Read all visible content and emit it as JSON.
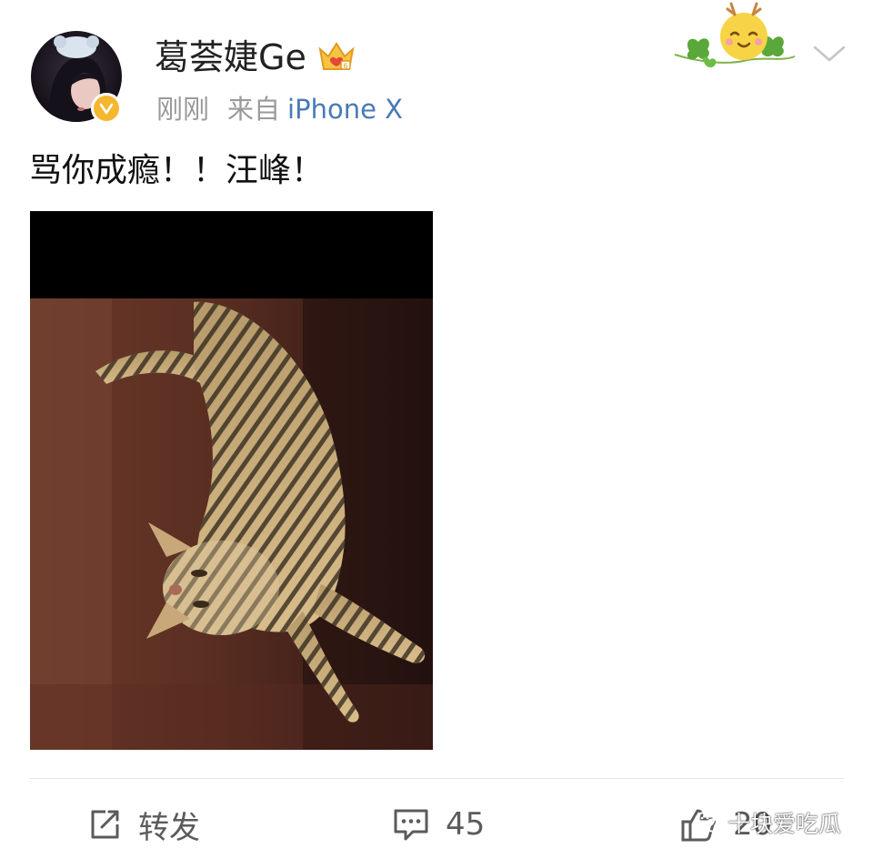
{
  "post": {
    "author": "葛荟婕Ge",
    "time": "刚刚",
    "source_prefix": "来自",
    "source_device": "iPhone X",
    "text": "骂你成瘾！！汪峰！"
  },
  "actions": {
    "repost_label": "转发",
    "comment_count": "45",
    "like_count": "20"
  },
  "watermark": {
    "text": "十块爱吃瓜"
  },
  "icons": {
    "verified": "verified-badge-icon",
    "member": "crown-icon",
    "menu": "chevron-down-icon",
    "repost": "share-icon",
    "comment": "comment-icon",
    "like": "thumbs-up-icon"
  },
  "colors": {
    "verified": "#f5b72f",
    "link": "#4a7ab5",
    "muted": "#9a9a9a"
  }
}
